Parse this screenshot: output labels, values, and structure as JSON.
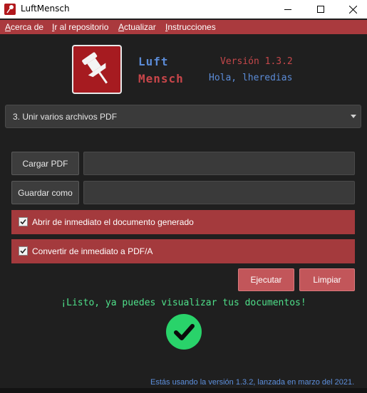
{
  "window": {
    "title": "LuftMensch"
  },
  "menu": {
    "items": [
      "Acerca de",
      "Ir al repositorio",
      "Actualizar",
      "Instrucciones"
    ]
  },
  "header": {
    "brand_line1": "Luft",
    "brand_line2": "Mensch",
    "version": "Versión 1.3.2",
    "greeting": "Hola, lheredias",
    "logo_icon": "pushpin-icon"
  },
  "mode_select": {
    "value": "3. Unir varios archivos PDF"
  },
  "buttons": {
    "load_pdf": "Cargar PDF",
    "save_as": "Guardar como",
    "execute": "Ejecutar",
    "clear": "Limpiar"
  },
  "fields": {
    "load_path": "",
    "save_path": ""
  },
  "options": [
    {
      "label": "Abrir de inmediato el documento generado",
      "checked": true
    },
    {
      "label": "Convertir de inmediato a PDF/A",
      "checked": true
    }
  ],
  "status": {
    "message": "¡Listo, ya puedes visualizar tus documentos!",
    "icon": "check-circle-icon"
  },
  "footer": {
    "text": "Estás usando la versión 1.3.2, lanzada en marzo del 2021."
  },
  "colors": {
    "accent": "#aa3a3e",
    "brand_blue": "#5b8bd6",
    "brand_red": "#c9464a",
    "success": "#29d36a",
    "background": "#1f1f1f"
  }
}
